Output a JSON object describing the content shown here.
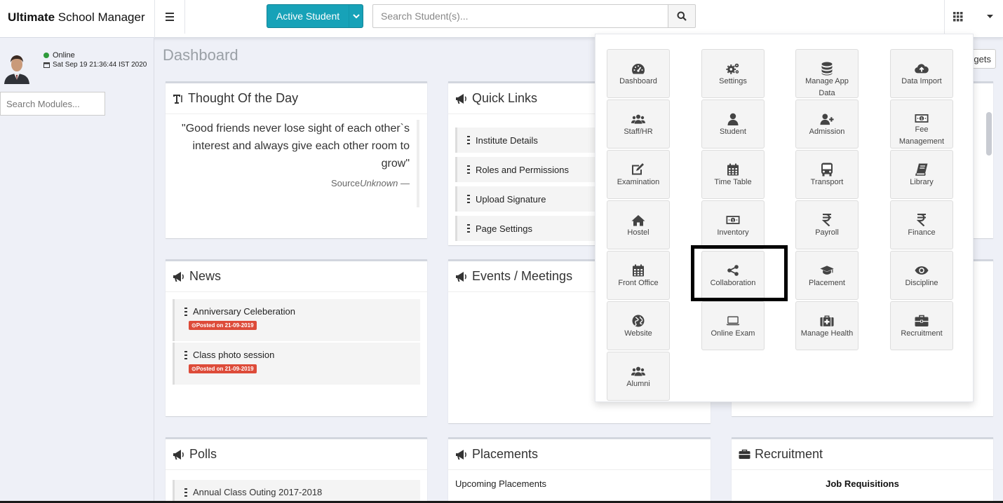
{
  "brand": {
    "bold": "Ultimate",
    "rest": " School Manager"
  },
  "header": {
    "active_student_label": "Active Student",
    "search_placeholder": "Search Student(s)...",
    "icons": [
      "hamburger-icon",
      "search-icon",
      "apps-grid-icon",
      "chevron-down-icon"
    ]
  },
  "sidebar": {
    "status": "Online",
    "datetime": "Sat Sep 19 21:36:44 IST 2020",
    "search_placeholder": "Search Modules..."
  },
  "page": {
    "title": "Dashboard",
    "widgets_label": "gets"
  },
  "thought": {
    "title": "Thought Of the Day",
    "quote": "\"Good friends never lose sight of each other`s interest and always give each other room to grow\"",
    "source_label": "Source",
    "source_name": "Unknown",
    "source_suffix": " —"
  },
  "quick_links": {
    "title": "Quick Links",
    "items": [
      "Institute Details",
      "Roles and Permissions",
      "Upload Signature",
      "Page Settings"
    ]
  },
  "news": {
    "title": "News",
    "items": [
      {
        "label": "Anniversary Celeberation",
        "badge": "Posted on 21-09-2019"
      },
      {
        "label": "Class photo session",
        "badge": "Posted on 21-09-2019"
      }
    ]
  },
  "events": {
    "title": "Events / Meetings"
  },
  "polls": {
    "title": "Polls",
    "items": [
      "Annual Class Outing 2017-2018"
    ]
  },
  "placements": {
    "title": "Placements",
    "subtitle": "Upcoming Placements"
  },
  "recruitment": {
    "title": "Recruitment",
    "subtitle": "Job Requisitions"
  },
  "apps": [
    {
      "label": "Dashboard",
      "icon": "dashboard-icon"
    },
    {
      "label": "Settings",
      "icon": "gears-icon"
    },
    {
      "label": "Manage App Data",
      "icon": "database-icon"
    },
    {
      "label": "Data Import",
      "icon": "cloud-upload-icon"
    },
    {
      "label": "Staff/HR",
      "icon": "users-icon"
    },
    {
      "label": "Student",
      "icon": "user-icon"
    },
    {
      "label": "Admission",
      "icon": "user-plus-icon"
    },
    {
      "label": "Fee Management",
      "icon": "money-icon"
    },
    {
      "label": "Examination",
      "icon": "edit-icon"
    },
    {
      "label": "Time Table",
      "icon": "calendar-icon"
    },
    {
      "label": "Transport",
      "icon": "bus-icon"
    },
    {
      "label": "Library",
      "icon": "book-icon"
    },
    {
      "label": "Hostel",
      "icon": "home-icon"
    },
    {
      "label": "Inventory",
      "icon": "money-icon"
    },
    {
      "label": "Payroll",
      "icon": "rupee-icon"
    },
    {
      "label": "Finance",
      "icon": "rupee-icon"
    },
    {
      "label": "Front Office",
      "icon": "calendar-icon"
    },
    {
      "label": "Collaboration",
      "icon": "share-icon"
    },
    {
      "label": "Placement",
      "icon": "graduation-cap-icon"
    },
    {
      "label": "Discipline",
      "icon": "eye-icon"
    },
    {
      "label": "Website",
      "icon": "globe-icon"
    },
    {
      "label": "Online Exam",
      "icon": "laptop-icon"
    },
    {
      "label": "Manage Health",
      "icon": "medkit-icon"
    },
    {
      "label": "Recruitment",
      "icon": "briefcase-icon"
    },
    {
      "label": "Alumni",
      "icon": "users-icon"
    }
  ],
  "colors": {
    "accent": "#17a2b8",
    "online": "#2e9a3b",
    "badge": "#dd4b39",
    "background": "#eef0f7"
  }
}
